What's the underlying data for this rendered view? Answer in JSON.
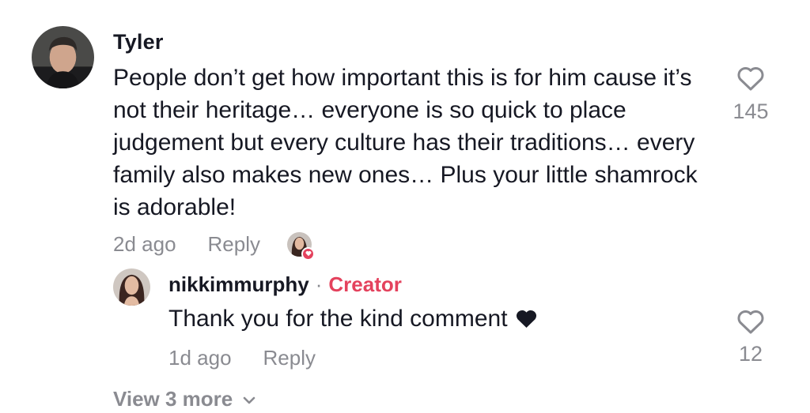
{
  "comment": {
    "username": "Tyler",
    "text": "People don’t get how important this is for him cause it’s not their heritage… everyone is so quick to place judgement but every culture has their traditions… every family also makes new ones… Plus your little shamrock is adorable!",
    "time": "2d ago",
    "reply_label": "Reply",
    "like_count": "145",
    "like_icon": "heart-outline-icon",
    "creator_liked_icon": "creator-liked-avatar"
  },
  "reply": {
    "username": "nikkimmurphy",
    "separator": "·",
    "badge": "Creator",
    "text": "Thank you for the kind comment",
    "time": "1d ago",
    "reply_label": "Reply",
    "like_count": "12",
    "like_icon": "heart-outline-icon",
    "trailing_icon": "heart-solid-icon"
  },
  "view_more": {
    "label": "View 3 more",
    "icon": "chevron-down-icon"
  },
  "colors": {
    "text_primary": "#161823",
    "text_secondary": "#8a8b91",
    "creator_accent": "#e4425d"
  }
}
